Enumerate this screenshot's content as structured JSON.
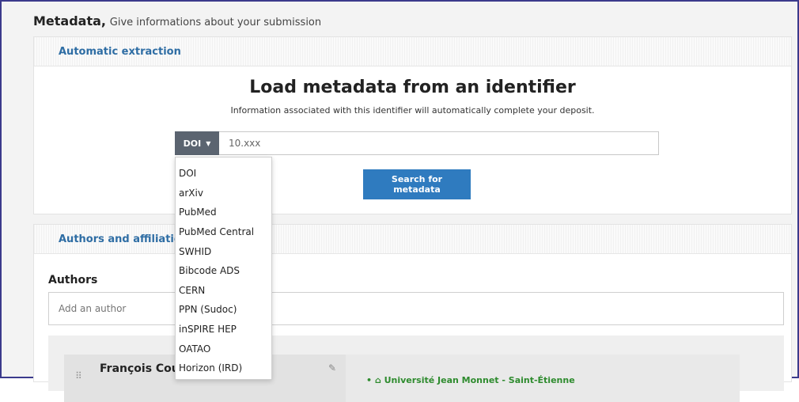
{
  "page": {
    "title": "Metadata,",
    "subtitle": "Give informations about your submission"
  },
  "extraction": {
    "header": "Automatic extraction",
    "heading": "Load metadata from an identifier",
    "description": "Information associated with this identifier will automatically complete your deposit.",
    "selected_type": "DOI",
    "input_value": "10.xxx",
    "search_button": "Search for metadata"
  },
  "dropdown": {
    "options": [
      "DOI",
      "arXiv",
      "PubMed",
      "PubMed Central",
      "SWHID",
      "Bibcode ADS",
      "CERN",
      "PPN (Sudoc)",
      "inSPIRE HEP",
      "OATAO",
      "Horizon (IRD)"
    ]
  },
  "authors": {
    "header": "Authors and affiliatio",
    "label": "Authors",
    "input_placeholder": "Add an author",
    "author_name": "François Cou",
    "affiliation": "• ⌂ Université Jean Monnet - Saint-Étienne"
  },
  "icons": {
    "caret": "caret-down-icon",
    "drag": "drag-handle-icon",
    "edit": "pencil-icon"
  }
}
